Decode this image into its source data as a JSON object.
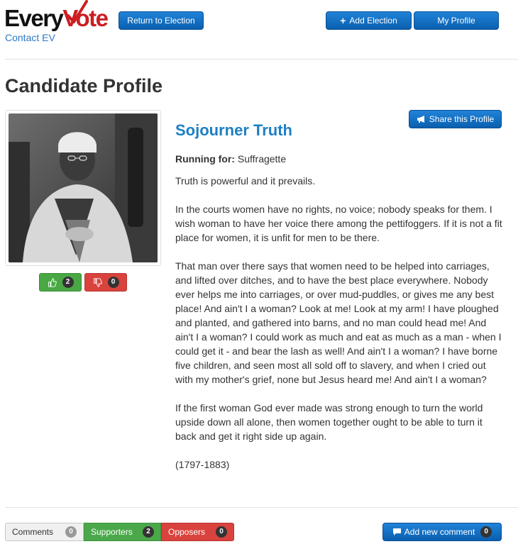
{
  "header": {
    "logo_every": "Every",
    "logo_vote": "Vote",
    "contact_label": "Contact EV",
    "return_label": "Return to Election",
    "add_election_label": "Add Election",
    "my_profile_label": "My Profile"
  },
  "page": {
    "title": "Candidate Profile",
    "share_label": "Share this Profile"
  },
  "candidate": {
    "name": "Sojourner Truth",
    "running_label": "Running for:",
    "running_value": "Suffragette",
    "upvotes": "2",
    "downvotes": "0",
    "bio": [
      "Truth is powerful and it prevails.",
      "In the courts women have no rights, no voice; nobody speaks for them. I wish woman to have her voice there among the pettifoggers. If it is not a fit place for women, it is unfit for men to be there.",
      "That man over there says that women need to be helped into carriages, and lifted over ditches, and to have the best place everywhere. Nobody ever helps me into carriages, or over mud-puddles, or gives me any best place! And ain't I a woman? Look at me! Look at my arm! I have ploughed and planted, and gathered into barns, and no man could head me! And ain't I a woman? I could work as much and eat as much as a man - when I could get it - and bear the lash as well! And ain't I a woman? I have borne five children, and seen most all sold off to slavery, and when I cried out with my mother's grief, none but Jesus heard me! And ain't I a woman?",
      "If the first woman God ever made was strong enough to turn the world upside down all alone, then women together ought to be able to turn it back and get it right side up again.",
      "(1797-1883)"
    ]
  },
  "footer": {
    "comments_label": "Comments",
    "comments_count": "0",
    "supporters_label": "Supporters",
    "supporters_count": "2",
    "opposers_label": "Opposers",
    "opposers_count": "0",
    "add_comment_label": "Add new comment",
    "add_comment_count": "0"
  },
  "colors": {
    "brand_red": "#cc1e22",
    "primary_blue": "#0f6fc6",
    "name_blue": "#1e7fc4",
    "success_green": "#49a844",
    "danger_red": "#d9433d"
  }
}
